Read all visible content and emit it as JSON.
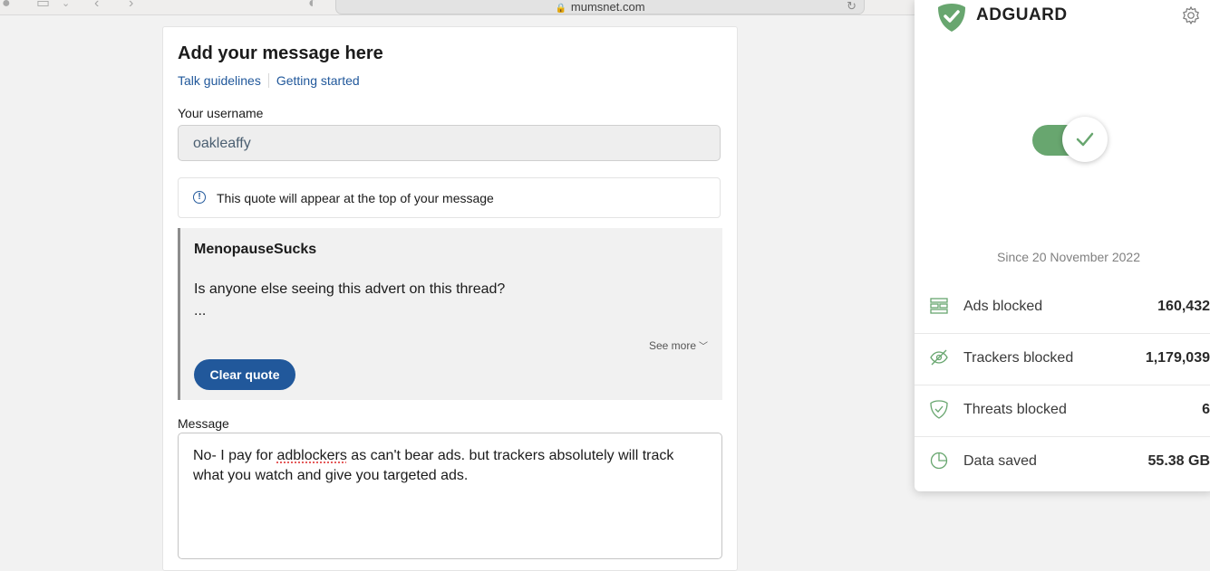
{
  "browser": {
    "url": "mumsnet.com"
  },
  "form": {
    "title": "Add your message here",
    "links": [
      "Talk guidelines",
      "Getting started"
    ],
    "username_label": "Your username",
    "username_value": "oakleaffy",
    "quote_notice": "This quote will appear at the top of your message",
    "quote": {
      "author": "MenopauseSucks",
      "text": "Is anyone else seeing this advert on this thread?",
      "ellipsis": "...",
      "see_more": "See more",
      "clear_button": "Clear quote"
    },
    "message_label": "Message",
    "message_text_before": "No- I pay for ",
    "message_misspelled": "adblockers",
    "message_text_after": " as can't bear ads. but trackers absolutely will track what you watch and give you targeted ads."
  },
  "adguard": {
    "name": "ADGUARD",
    "protection_enabled": true,
    "since": "Since 20 November 2022",
    "accent_color": "#68a66f",
    "stats": [
      {
        "icon": "ads-icon",
        "label": "Ads blocked",
        "value": "160,432"
      },
      {
        "icon": "tracker-icon",
        "label": "Trackers blocked",
        "value": "1,179,039"
      },
      {
        "icon": "threat-shield-icon",
        "label": "Threats blocked",
        "value": "6"
      },
      {
        "icon": "pie-chart-icon",
        "label": "Data saved",
        "value": "55.38 GB"
      }
    ]
  }
}
